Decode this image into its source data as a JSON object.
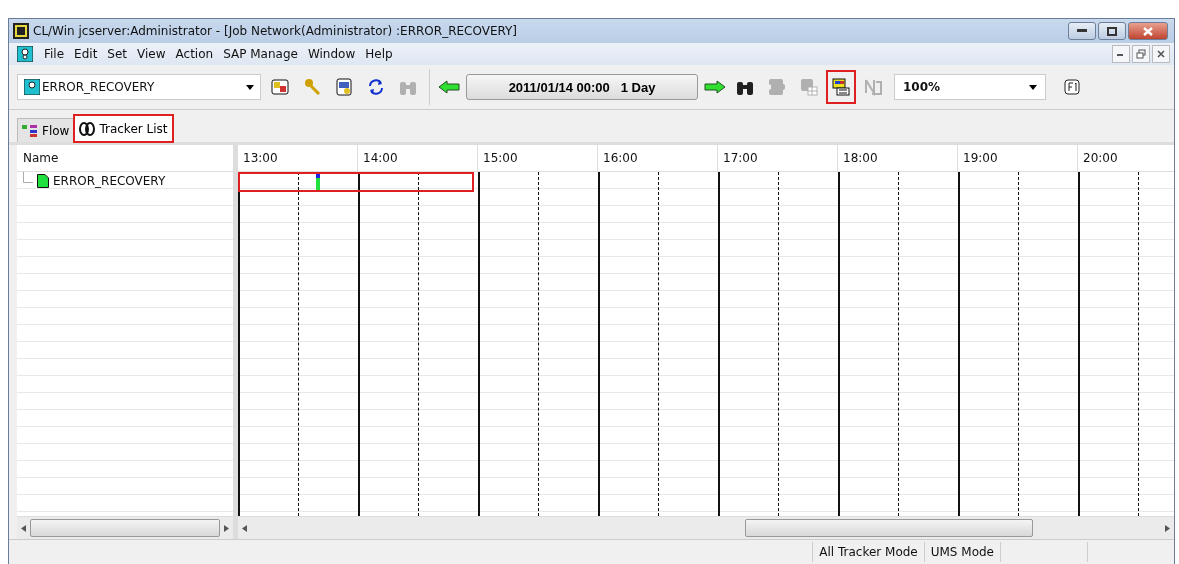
{
  "window": {
    "title": "CL/Win jcserver:Administrator - [Job Network(Administrator) :ERROR_RECOVERY]"
  },
  "menu": [
    "File",
    "Edit",
    "Set",
    "View",
    "Action",
    "SAP Manage",
    "Window",
    "Help"
  ],
  "toolbar": {
    "network_select": "ERROR_RECOVERY",
    "left_tools": [
      {
        "kind": "open",
        "disabled": false
      },
      {
        "kind": "keys",
        "disabled": false
      },
      {
        "kind": "doc",
        "disabled": false
      },
      {
        "kind": "refresh",
        "disabled": false
      },
      {
        "kind": "find",
        "disabled": true
      }
    ],
    "date_range": "2011/01/14 00:00   1 Day",
    "right_tools": [
      {
        "kind": "find",
        "disabled": false,
        "highlighted": false
      },
      {
        "kind": "stack",
        "disabled": true,
        "highlighted": false
      },
      {
        "kind": "grid",
        "disabled": true,
        "highlighted": false
      },
      {
        "kind": "switch",
        "disabled": false,
        "highlighted": true
      },
      {
        "kind": "net",
        "disabled": true,
        "highlighted": false
      }
    ],
    "zoom": "100%"
  },
  "tabs": [
    {
      "label": "Flow",
      "selected": false,
      "highlighted": false
    },
    {
      "label": "Tracker List",
      "selected": true,
      "highlighted": true
    }
  ],
  "list": {
    "column": "Name",
    "items": [
      {
        "name": "ERROR_RECOVERY",
        "highlighted": true
      }
    ]
  },
  "timeline": {
    "hours": [
      "13:00",
      "14:00",
      "15:00",
      "16:00",
      "17:00",
      "18:00",
      "19:00",
      "20:00"
    ]
  },
  "status_bar": [
    "All Tracker Mode",
    "UMS Mode"
  ]
}
